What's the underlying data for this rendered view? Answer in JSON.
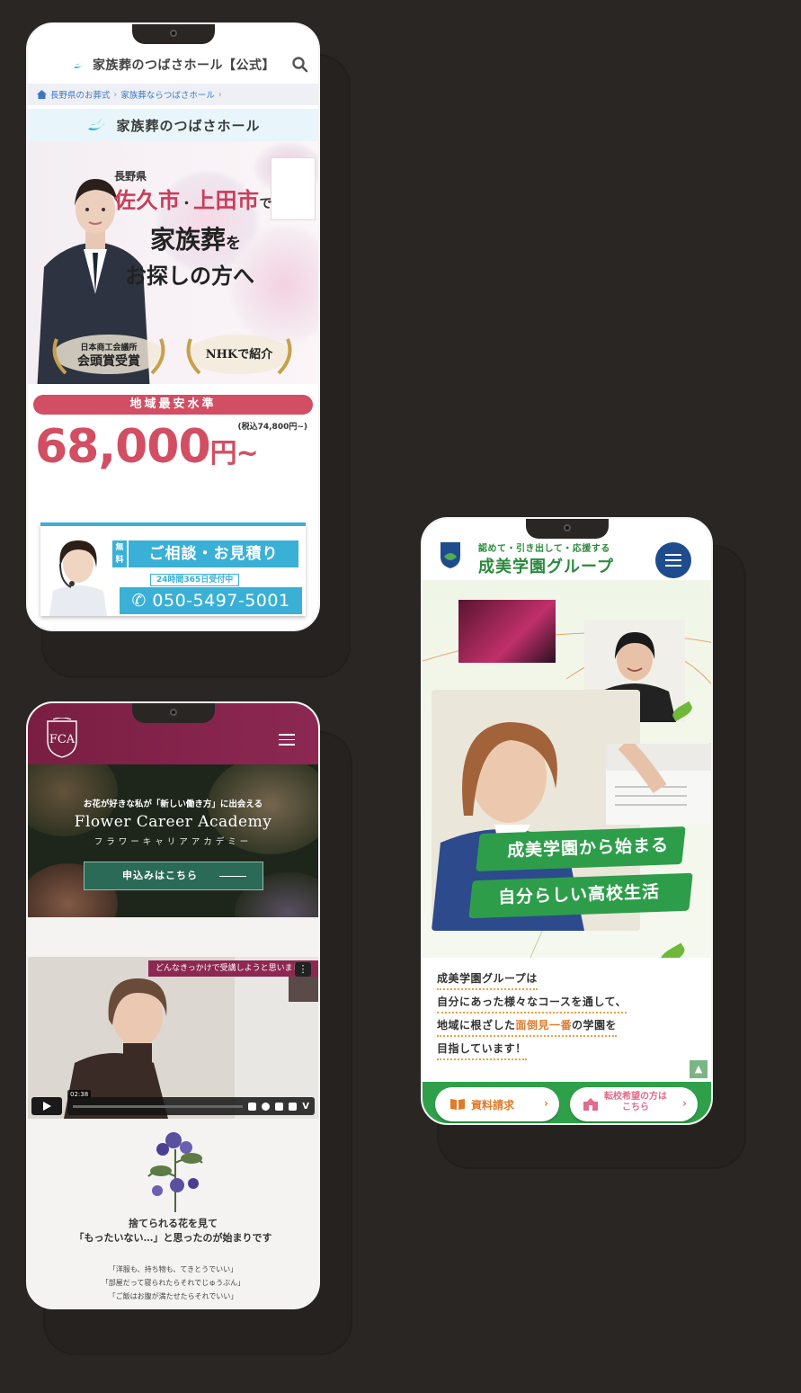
{
  "tsubasa": {
    "header_title": "家族葬のつばさホール【公式】",
    "breadcrumb": [
      "長野県のお葬式",
      "家族葬ならつばさホール"
    ],
    "brand": "家族葬のつばさホール",
    "hero": {
      "prefecture": "長野県",
      "cities": "佐久市",
      "dot": "・",
      "city2": "上田市",
      "particle1": "で",
      "headline": "家族葬",
      "particle2": "を",
      "tagline": "お探しの方へ"
    },
    "awards": [
      {
        "line1": "日本商工会議所",
        "line2": "会頭賞受賞"
      },
      {
        "line1": "NHKで紹介"
      }
    ],
    "price_badge": "地域最安水準",
    "price_tax": "(税込74,800円~)",
    "price": "68,000",
    "price_unit": "円~",
    "contact": {
      "free": "無料",
      "title": "ご相談・お見積り",
      "hours": "24時間365日受付中",
      "phone": "050-5497-5001"
    },
    "colors": {
      "accent": "#d24e63",
      "contact": "#3ab0d6"
    }
  },
  "fca": {
    "hero_sub": "お花が好きな私が「新しい働き方」に出会える",
    "hero_title": "Flower Career Academy",
    "hero_kana": "フラワーキャリアアカデミー",
    "cta": "申込みはこちら",
    "video_title": "どんなきっかけで受講しようと思いまし",
    "video_time": "02:38",
    "story_line1": "捨てられる花を見て",
    "story_line2": "「もったいない…」と思ったのが始まりです",
    "quotes": [
      "「洋服も、持ち物も、てきとうでいい」",
      "「部屋だって寝られたらそれでじゅうぶん」",
      "「ご飯はお腹が満たせたらそれでいい」"
    ],
    "colors": {
      "header": "#8c2852",
      "cta": "#2a6a57"
    }
  },
  "seibi": {
    "tagline": "認めて・引き出して・応援する",
    "name": "成美学園グループ",
    "catch1": "成美学園から始まる",
    "catch2": "自分らしい高校生活",
    "intro": [
      {
        "before": "成美学園グループは",
        "hl": "",
        "after": ""
      },
      {
        "before": "自分にあった様々なコースを通して、",
        "hl": "",
        "after": ""
      },
      {
        "before": "地域に根ざした",
        "hl": "面倒見一番",
        "after": "の学園を"
      },
      {
        "before": "目指しています！",
        "hl": "",
        "after": ""
      }
    ],
    "btn_docs": "資料請求",
    "btn_transfer_1": "転校希望の方は",
    "btn_transfer_2": "こちら",
    "colors": {
      "brand": "#2a8a3d",
      "nav": "#1f4c8c",
      "highlight": "#e07b2a"
    }
  }
}
